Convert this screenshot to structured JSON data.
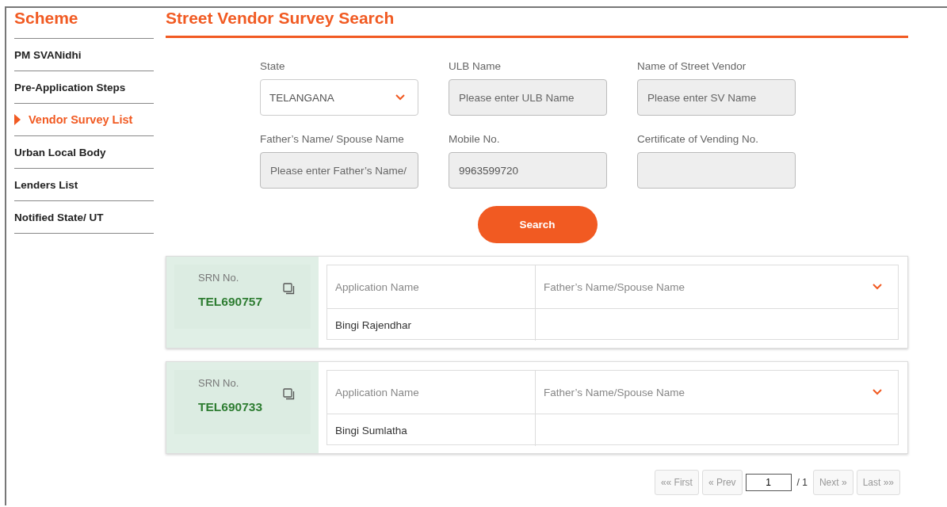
{
  "sidebar": {
    "title": "Scheme",
    "items": [
      {
        "label": "PM SVANidhi",
        "selected": false
      },
      {
        "label": "Pre-Application Steps",
        "selected": false
      },
      {
        "label": "Vendor Survey List",
        "selected": true
      },
      {
        "label": "Urban Local Body",
        "selected": false
      },
      {
        "label": "Lenders List",
        "selected": false
      },
      {
        "label": "Notified State/ UT",
        "selected": false
      }
    ]
  },
  "page_title": "Street Vendor Survey Search",
  "form": {
    "fields": [
      {
        "label": "State",
        "kind": "select",
        "value": "TELANGANA"
      },
      {
        "label": "ULB Name",
        "kind": "input",
        "placeholder": "Please enter ULB Name"
      },
      {
        "label": "Name of Street Vendor",
        "kind": "input",
        "placeholder": "Please enter SV Name"
      },
      {
        "label": "Father’s Name/ Spouse Name",
        "kind": "input",
        "placeholder": "Please enter Father’s Name/"
      },
      {
        "label": "Mobile No.",
        "kind": "input",
        "value": "9963599720"
      },
      {
        "label": "Certificate of Vending No.",
        "kind": "input"
      }
    ],
    "search_button": "Search"
  },
  "results": [
    {
      "srn_label": "SRN No.",
      "srn": "TEL690757",
      "columns": [
        "Application Name",
        "Father’s Name/Spouse Name"
      ],
      "values": [
        "Bingi Rajendhar"
      ]
    },
    {
      "srn_label": "SRN No.",
      "srn": "TEL690733",
      "columns": [
        "Application Name",
        "Father’s Name/Spouse Name"
      ],
      "values": [
        "Bingi Sumlatha"
      ]
    }
  ],
  "pagination": {
    "first": {
      "label": "«« First",
      "disabled": true
    },
    "prev": {
      "label": "« Prev",
      "disabled": true
    },
    "page": "1",
    "total": "/ 1",
    "next": {
      "label": "Next »",
      "disabled": true
    },
    "last": {
      "label": "Last »»",
      "disabled": true
    }
  }
}
